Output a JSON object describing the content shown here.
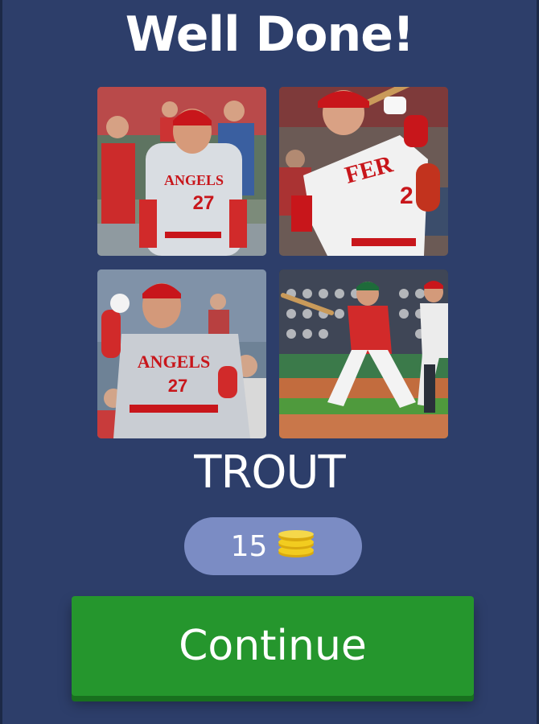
{
  "screen": {
    "title": "Well Done!",
    "answer": "TROUT"
  },
  "photos": [
    {
      "jersey_text": "ANGELS",
      "number": "27"
    },
    {
      "jersey_text": "FER",
      "number": "2"
    },
    {
      "jersey_text": "ANGELS",
      "number": "27"
    },
    {
      "jersey_text": "",
      "number": ""
    }
  ],
  "reward": {
    "value": "15",
    "icon": "coin-stack-icon"
  },
  "continue_button": {
    "label": "Continue"
  },
  "colors": {
    "background": "#2d3e6a",
    "reward_pill": "#7b8cc4",
    "button": "#25962d",
    "coin": "#f2cc1f"
  }
}
